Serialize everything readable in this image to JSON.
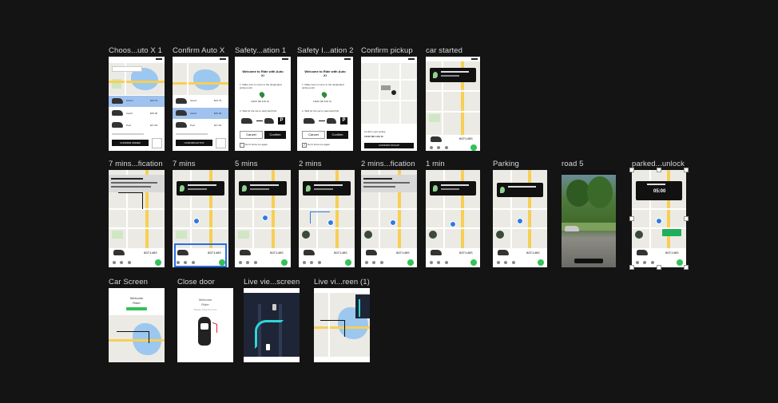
{
  "frames": {
    "f1": "Choos...uto X 1",
    "f2": "Confirm Auto X",
    "f3": "Safety...ation 1",
    "f4": "Safety I...ation 2",
    "f5": "Confirm pickup",
    "f6": "car started",
    "f7": "7 mins...fication",
    "f8": "7 mins",
    "f9": "5 mins",
    "f10": "2 mins",
    "f11": "2 mins...fication",
    "f12": "1 min",
    "f13": "Parking",
    "f14": "road 5",
    "f15": "parked...unlock",
    "f16": "Car Screen",
    "f17": "Close door",
    "f18": "Live vie...screen",
    "f19": "Live vi...reen (1)"
  },
  "screens": {
    "choose": {
      "options": [
        {
          "name": "UberX",
          "price": "$33.79"
        },
        {
          "name": "AutoX",
          "price": "$25.00"
        },
        {
          "name": "Pool",
          "price": "$17.63"
        }
      ],
      "confirm_order": "CONFIRM ORDER",
      "confirm_autox": "CONFIRM AUTOX"
    },
    "safety": {
      "title": "Welcome to Ride with Auto X!",
      "step1": "1. Make sure to come to the designated pickup point",
      "address": "11100 NE 11th St",
      "step2": "2. Wait for the car to park itself first",
      "cancel": "Cancel",
      "confirm": "Confirm",
      "dont_show": "Don't show me again"
    },
    "pickup": {
      "label": "Confirm your pickup",
      "address": "11100 NE 11th St",
      "button": "CONFIRM PICKUP"
    },
    "plate": "8GT1465",
    "car_screen": {
      "welcome": "Welcome",
      "name": "Rider"
    },
    "close_door": {
      "welcome": "Welcome",
      "name": "Rider",
      "hint": "Please close the door"
    },
    "parked": {
      "time": "05:00"
    }
  }
}
